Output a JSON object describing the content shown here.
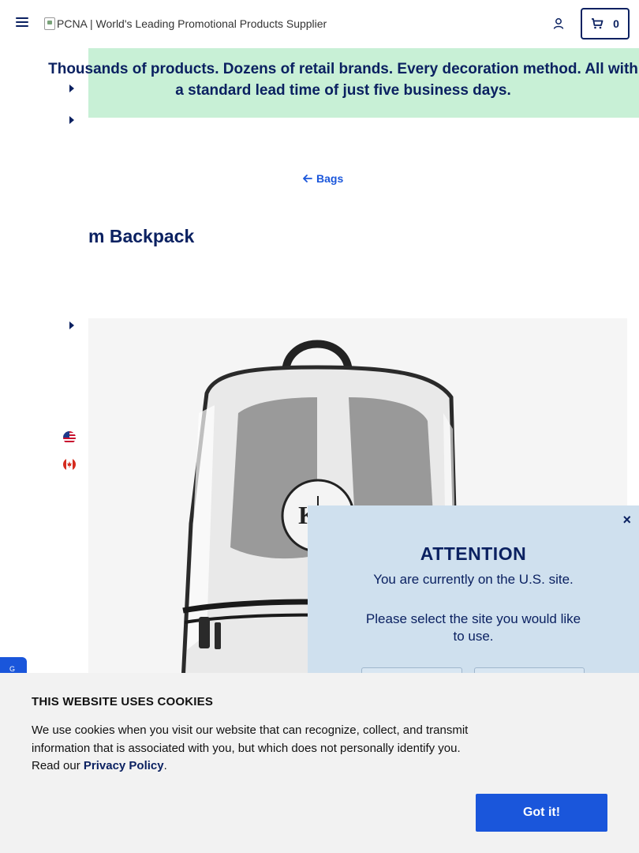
{
  "header": {
    "logo_alt": "PCNA | World's Leading Promotional Products Supplier",
    "cart_count": "0"
  },
  "promo": {
    "text_partial": "Thousands of products. Dozens of retail brands. Every decoration method. All with a standard lead time of just five business days.",
    "bg_color": "#c8f0d6"
  },
  "breadcrumb": {
    "label": "Bags"
  },
  "product": {
    "title_partial": "m Backpack",
    "image_logo": "KG"
  },
  "modal": {
    "close_label": "×",
    "heading": "ATTENTION",
    "line1": "You are currently on the U.S. site.",
    "line2": "Please select the site you would like to use."
  },
  "cookie": {
    "title": "THIS WEBSITE USES COOKIES",
    "body_prefix": "We use cookies when you visit our website that can recognize, collect, and transmit information that is associated with you, but which does not personally identify you. Read our ",
    "privacy_link": "Privacy Policy",
    "body_suffix": ".",
    "button_label": "Got it!"
  },
  "side": {
    "tab_letter": "G"
  },
  "colors": {
    "navy": "#0b2161",
    "blue": "#1a56db",
    "modal_bg": "#cfe0ee",
    "cookie_bg": "#f2f2f2"
  }
}
